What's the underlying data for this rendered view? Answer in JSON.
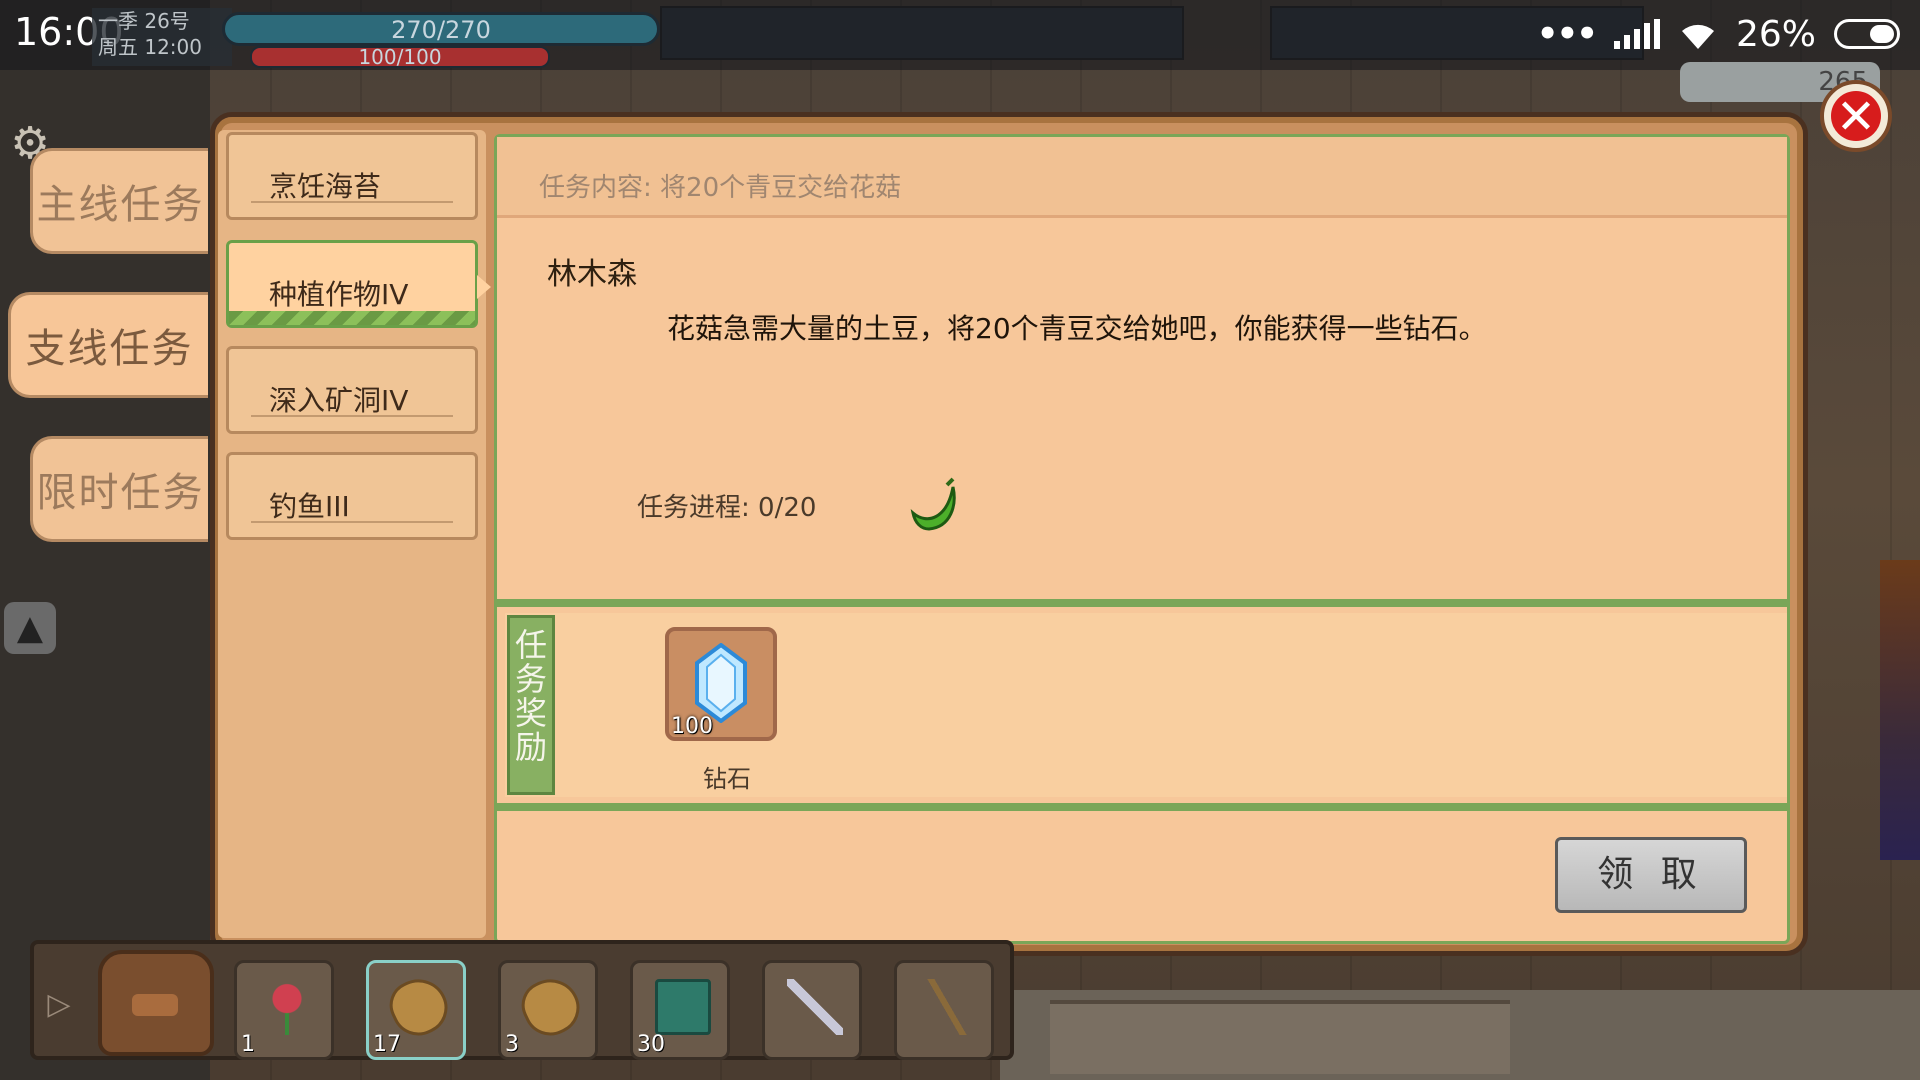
{
  "status": {
    "time": "16:00",
    "dots": "•••",
    "battery": "26%"
  },
  "hud": {
    "date_line1": "一季 26号",
    "date_line2": "周五 12:00",
    "hp": "270/270",
    "mp": "100/100",
    "coins": "265"
  },
  "side_tabs": [
    {
      "label": "主线任务",
      "active": false
    },
    {
      "label": "支线任务",
      "active": true
    },
    {
      "label": "限时任务",
      "active": false
    }
  ],
  "task_list": [
    {
      "label": "烹饪海苔",
      "active": false
    },
    {
      "label": "种植作物IV",
      "active": true
    },
    {
      "label": "深入矿洞IV",
      "active": false
    },
    {
      "label": "钓鱼III",
      "active": false
    }
  ],
  "detail": {
    "content_line": "任务内容:   将20个青豆交给花菇",
    "npc_name": "林木森",
    "description": "花菇急需大量的土豆，将20个青豆交给她吧，你能获得一些钻石。",
    "progress": "任务进程:   0/20",
    "reward_label": "任务奖励",
    "reward": {
      "name": "钻石",
      "count": "100",
      "icon": "diamond-icon"
    },
    "claim_button": "领 取"
  },
  "hotbar": [
    {
      "icon": "rose-icon",
      "count": "1"
    },
    {
      "icon": "potato-icon",
      "count": "17",
      "selected": true
    },
    {
      "icon": "potato-icon",
      "count": "3"
    },
    {
      "icon": "book-icon",
      "count": "30"
    },
    {
      "icon": "sword-icon",
      "count": ""
    },
    {
      "icon": "fishing-rod-icon",
      "count": ""
    }
  ],
  "colors": {
    "panel": "#c9905f",
    "content": "#f7c79a",
    "accent_green": "#7aa658",
    "close_red": "#d71c1c"
  }
}
